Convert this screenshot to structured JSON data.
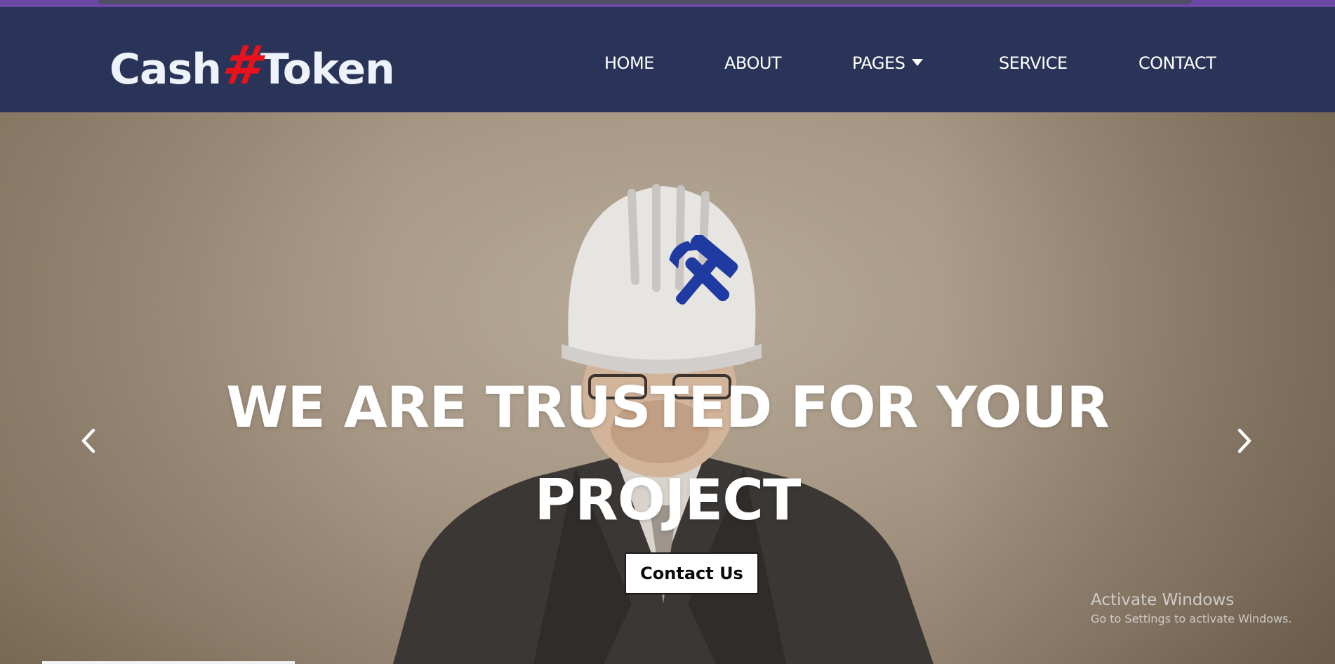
{
  "brand": {
    "part1": "Cash",
    "hash": "#",
    "part2": "Token",
    "hash_color": "#e8111c"
  },
  "nav": {
    "items": [
      {
        "label": "HOME"
      },
      {
        "label": "ABOUT"
      },
      {
        "label": "PAGES",
        "icon": "caret-down-icon"
      },
      {
        "label": "SERVICE"
      },
      {
        "label": "CONTACT"
      }
    ]
  },
  "hero": {
    "icon": "tools-icon",
    "icon_color": "#1f3aa0",
    "headline_line1": "WE ARE TRUSTED FOR YOUR",
    "headline_line2": "PROJECT",
    "cta_label": "Contact Us",
    "prev_icon": "chevron-left-icon",
    "next_icon": "chevron-right-icon"
  },
  "os_watermark": {
    "title": "Activate Windows",
    "subtitle": "Go to Settings to activate Windows."
  },
  "colors": {
    "header_bg": "#2a3458",
    "browser_strip": "#6c48a6"
  }
}
